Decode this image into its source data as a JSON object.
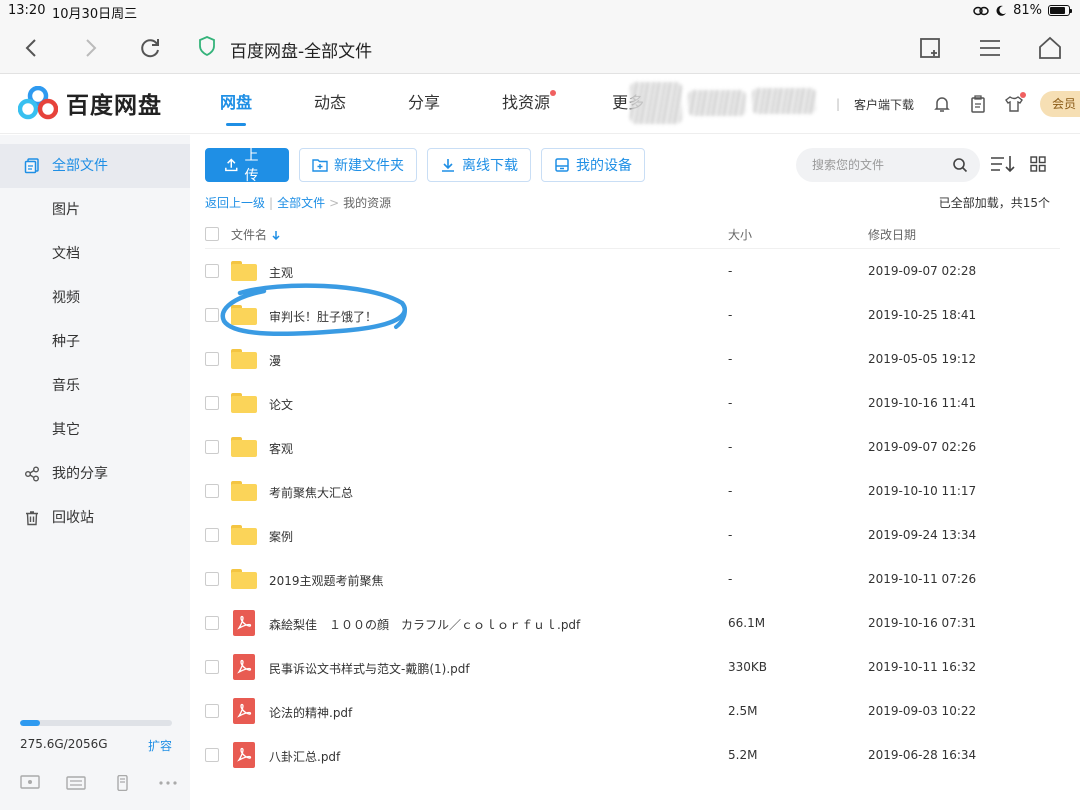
{
  "status": {
    "time": "13:20",
    "date": "10月30日周三",
    "battery": "81%",
    "battery_level": 0.81
  },
  "browser": {
    "title": "百度网盘-全部文件"
  },
  "app": {
    "logo": "百度网盘",
    "nav": [
      {
        "label": "网盘",
        "active": true
      },
      {
        "label": "动态"
      },
      {
        "label": "分享"
      },
      {
        "label": "找资源",
        "dot": true
      },
      {
        "label": "更多"
      }
    ],
    "client_download": "客户端下载",
    "vip": "会员"
  },
  "sidebar": {
    "items": [
      {
        "label": "全部文件",
        "active": true
      },
      {
        "label": "图片"
      },
      {
        "label": "文档"
      },
      {
        "label": "视频"
      },
      {
        "label": "种子"
      },
      {
        "label": "音乐"
      },
      {
        "label": "其它"
      },
      {
        "label": "我的分享"
      },
      {
        "label": "回收站"
      }
    ],
    "quota": {
      "text": "275.6G/2056G",
      "used_fraction": 0.134,
      "expand": "扩容"
    }
  },
  "toolbar": {
    "upload": "上传",
    "new_folder": "新建文件夹",
    "offline_download": "离线下载",
    "my_devices": "我的设备",
    "search_placeholder": "搜索您的文件"
  },
  "breadcrumb": {
    "back": "返回上一级",
    "all": "全部文件",
    "current": "我的资源",
    "sep1": "|",
    "sep2": ">"
  },
  "loaded_text": "已全部加载，共15个",
  "table": {
    "headers": {
      "name": "文件名",
      "size": "大小",
      "date": "修改日期"
    },
    "rows": [
      {
        "name": "主观",
        "size": "-",
        "date": "2019-09-07 02:28",
        "type": "folder"
      },
      {
        "name": "审判长！肚子饿了！",
        "size": "-",
        "date": "2019-10-25 18:41",
        "type": "folder"
      },
      {
        "name": "漫",
        "size": "-",
        "date": "2019-05-05 19:12",
        "type": "folder"
      },
      {
        "name": "论文",
        "size": "-",
        "date": "2019-10-16 11:41",
        "type": "folder"
      },
      {
        "name": "客观",
        "size": "-",
        "date": "2019-09-07 02:26",
        "type": "folder"
      },
      {
        "name": "考前聚焦大汇总",
        "size": "-",
        "date": "2019-10-10 11:17",
        "type": "folder"
      },
      {
        "name": "案例",
        "size": "-",
        "date": "2019-09-24 13:34",
        "type": "folder"
      },
      {
        "name": "2019主观题考前聚焦",
        "size": "-",
        "date": "2019-10-11 07:26",
        "type": "folder"
      },
      {
        "name": "森絵梨佳　１００の顔　カラフル／ｃｏｌｏｒｆｕｌ.pdf",
        "size": "66.1M",
        "date": "2019-10-16 07:31",
        "type": "pdf"
      },
      {
        "name": "民事诉讼文书样式与范文-戴鹏(1).pdf",
        "size": "330KB",
        "date": "2019-10-11 16:32",
        "type": "pdf"
      },
      {
        "name": "论法的精神.pdf",
        "size": "2.5M",
        "date": "2019-09-03 10:22",
        "type": "pdf"
      },
      {
        "name": "八卦汇总.pdf",
        "size": "5.2M",
        "date": "2019-06-28 16:34",
        "type": "pdf"
      }
    ]
  },
  "colors": {
    "accent": "#1f8fe5",
    "folder": "#fbd459",
    "pdf": "#e85b52",
    "annotation": "#3a9be3"
  }
}
